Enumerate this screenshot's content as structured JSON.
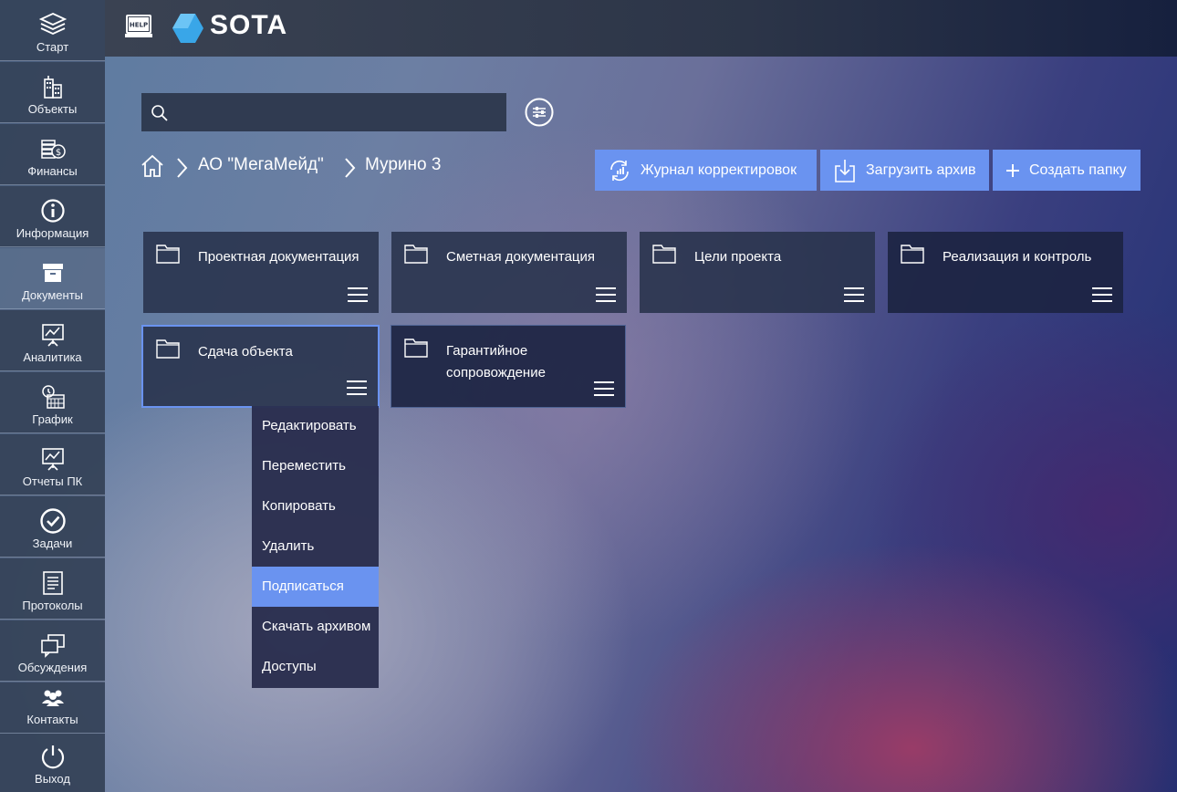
{
  "app": {
    "logo_text": "SOTA",
    "help_label": "HELP"
  },
  "sidebar": {
    "items": [
      {
        "label": "Старт",
        "icon": "layers-icon"
      },
      {
        "label": "Объекты",
        "icon": "buildings-icon"
      },
      {
        "label": "Финансы",
        "icon": "money-icon"
      },
      {
        "label": "Информация",
        "icon": "info-icon"
      },
      {
        "label": "Документы",
        "icon": "archive-box-icon",
        "active": true
      },
      {
        "label": "Аналитика",
        "icon": "presentation-chart-icon"
      },
      {
        "label": "График",
        "icon": "calendar-clock-icon"
      },
      {
        "label": "Отчеты ПК",
        "icon": "presentation-chart-icon"
      },
      {
        "label": "Задачи",
        "icon": "check-circle-icon"
      },
      {
        "label": "Протоколы",
        "icon": "document-list-icon"
      },
      {
        "label": "Обсуждения",
        "icon": "chat-windows-icon"
      },
      {
        "label": "Контакты",
        "icon": "contacts-icon"
      },
      {
        "label": "Выход",
        "icon": "power-icon"
      }
    ]
  },
  "search": {
    "value": "",
    "placeholder": ""
  },
  "breadcrumb": {
    "items": [
      "АО \"МегаМейд\"",
      "Мурино 3"
    ]
  },
  "actions": {
    "journal": "Журнал корректировок",
    "upload": "Загрузить архив",
    "create": "Создать папку"
  },
  "folders": [
    {
      "title": "Проектная документация"
    },
    {
      "title": "Сметная документация"
    },
    {
      "title": "Цели проекта"
    },
    {
      "title": "Реализация и контроль"
    },
    {
      "title": "Сдача объекта"
    },
    {
      "title": "Гарантийное сопровождение"
    }
  ],
  "context_menu": {
    "items": [
      "Редактировать",
      "Переместить",
      "Копировать",
      "Удалить",
      "Подписаться",
      "Скачать архивом",
      "Доступы"
    ],
    "highlighted": "Подписаться"
  },
  "colors": {
    "accent": "#6a93f0",
    "card": "#28324b",
    "sidebar": "#344258"
  }
}
